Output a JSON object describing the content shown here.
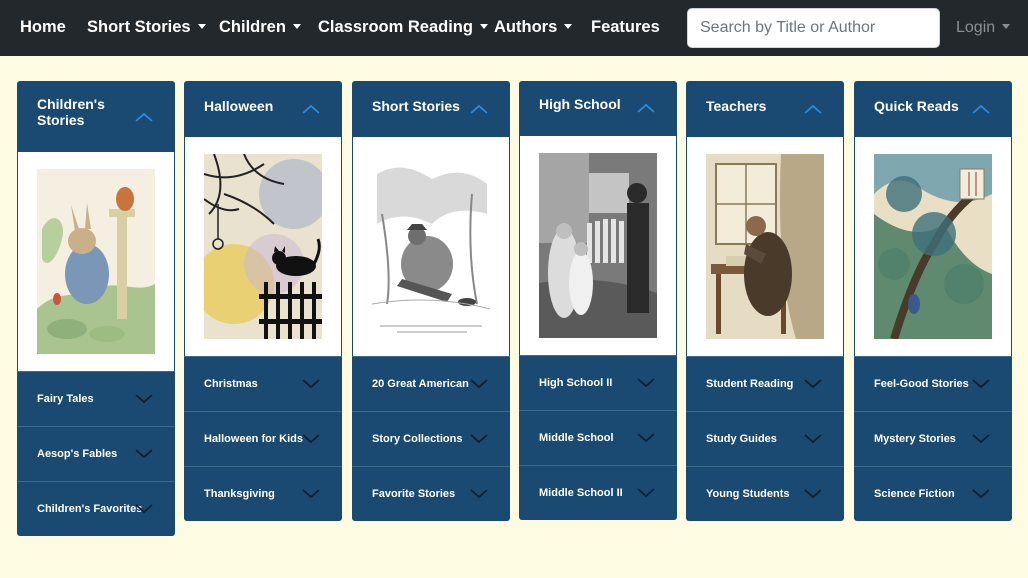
{
  "nav": {
    "home": "Home",
    "short_stories": "Short Stories",
    "children": "Children",
    "classroom_reading": "Classroom Reading",
    "authors": "Authors",
    "features": "Features",
    "search_placeholder": "Search by Title or Author",
    "login": "Login"
  },
  "columns": [
    {
      "title": "Children's Stories",
      "title_lines": [
        "Children's",
        "Stories"
      ],
      "image": "rabbit-in-garden-illustration",
      "subs": [
        "Fairy Tales",
        "Aesop's Fables",
        "Children's Favorites"
      ]
    },
    {
      "title": "Halloween",
      "image": "black-cat-on-fence-illustration",
      "subs": [
        "Christmas",
        "Halloween for Kids",
        "Thanksgiving"
      ]
    },
    {
      "title": "Short Stories",
      "image": "engraving-man-kneeling-illustration",
      "subs": [
        "20 Great American",
        "Story Collections",
        "Favorite Stories"
      ]
    },
    {
      "title": "High School",
      "image": "figures-by-picket-fence-illustration",
      "subs": [
        "High School II",
        "Middle School",
        "Middle School II"
      ]
    },
    {
      "title": "Teachers",
      "image": "woman-writing-at-desk-illustration",
      "subs": [
        "Student Reading",
        "Study Guides",
        "Young Students"
      ]
    },
    {
      "title": "Quick Reads",
      "image": "japanese-woodblock-landscape-illustration",
      "subs": [
        "Feel-Good Stories",
        "Mystery Stories",
        "Science Fiction"
      ]
    }
  ],
  "colors": {
    "navbar": "#23282d",
    "background": "#fefbe3",
    "panel": "#1a4a72",
    "chevron_up": "#2b8be0",
    "chevron_down": "#0d1f30"
  }
}
